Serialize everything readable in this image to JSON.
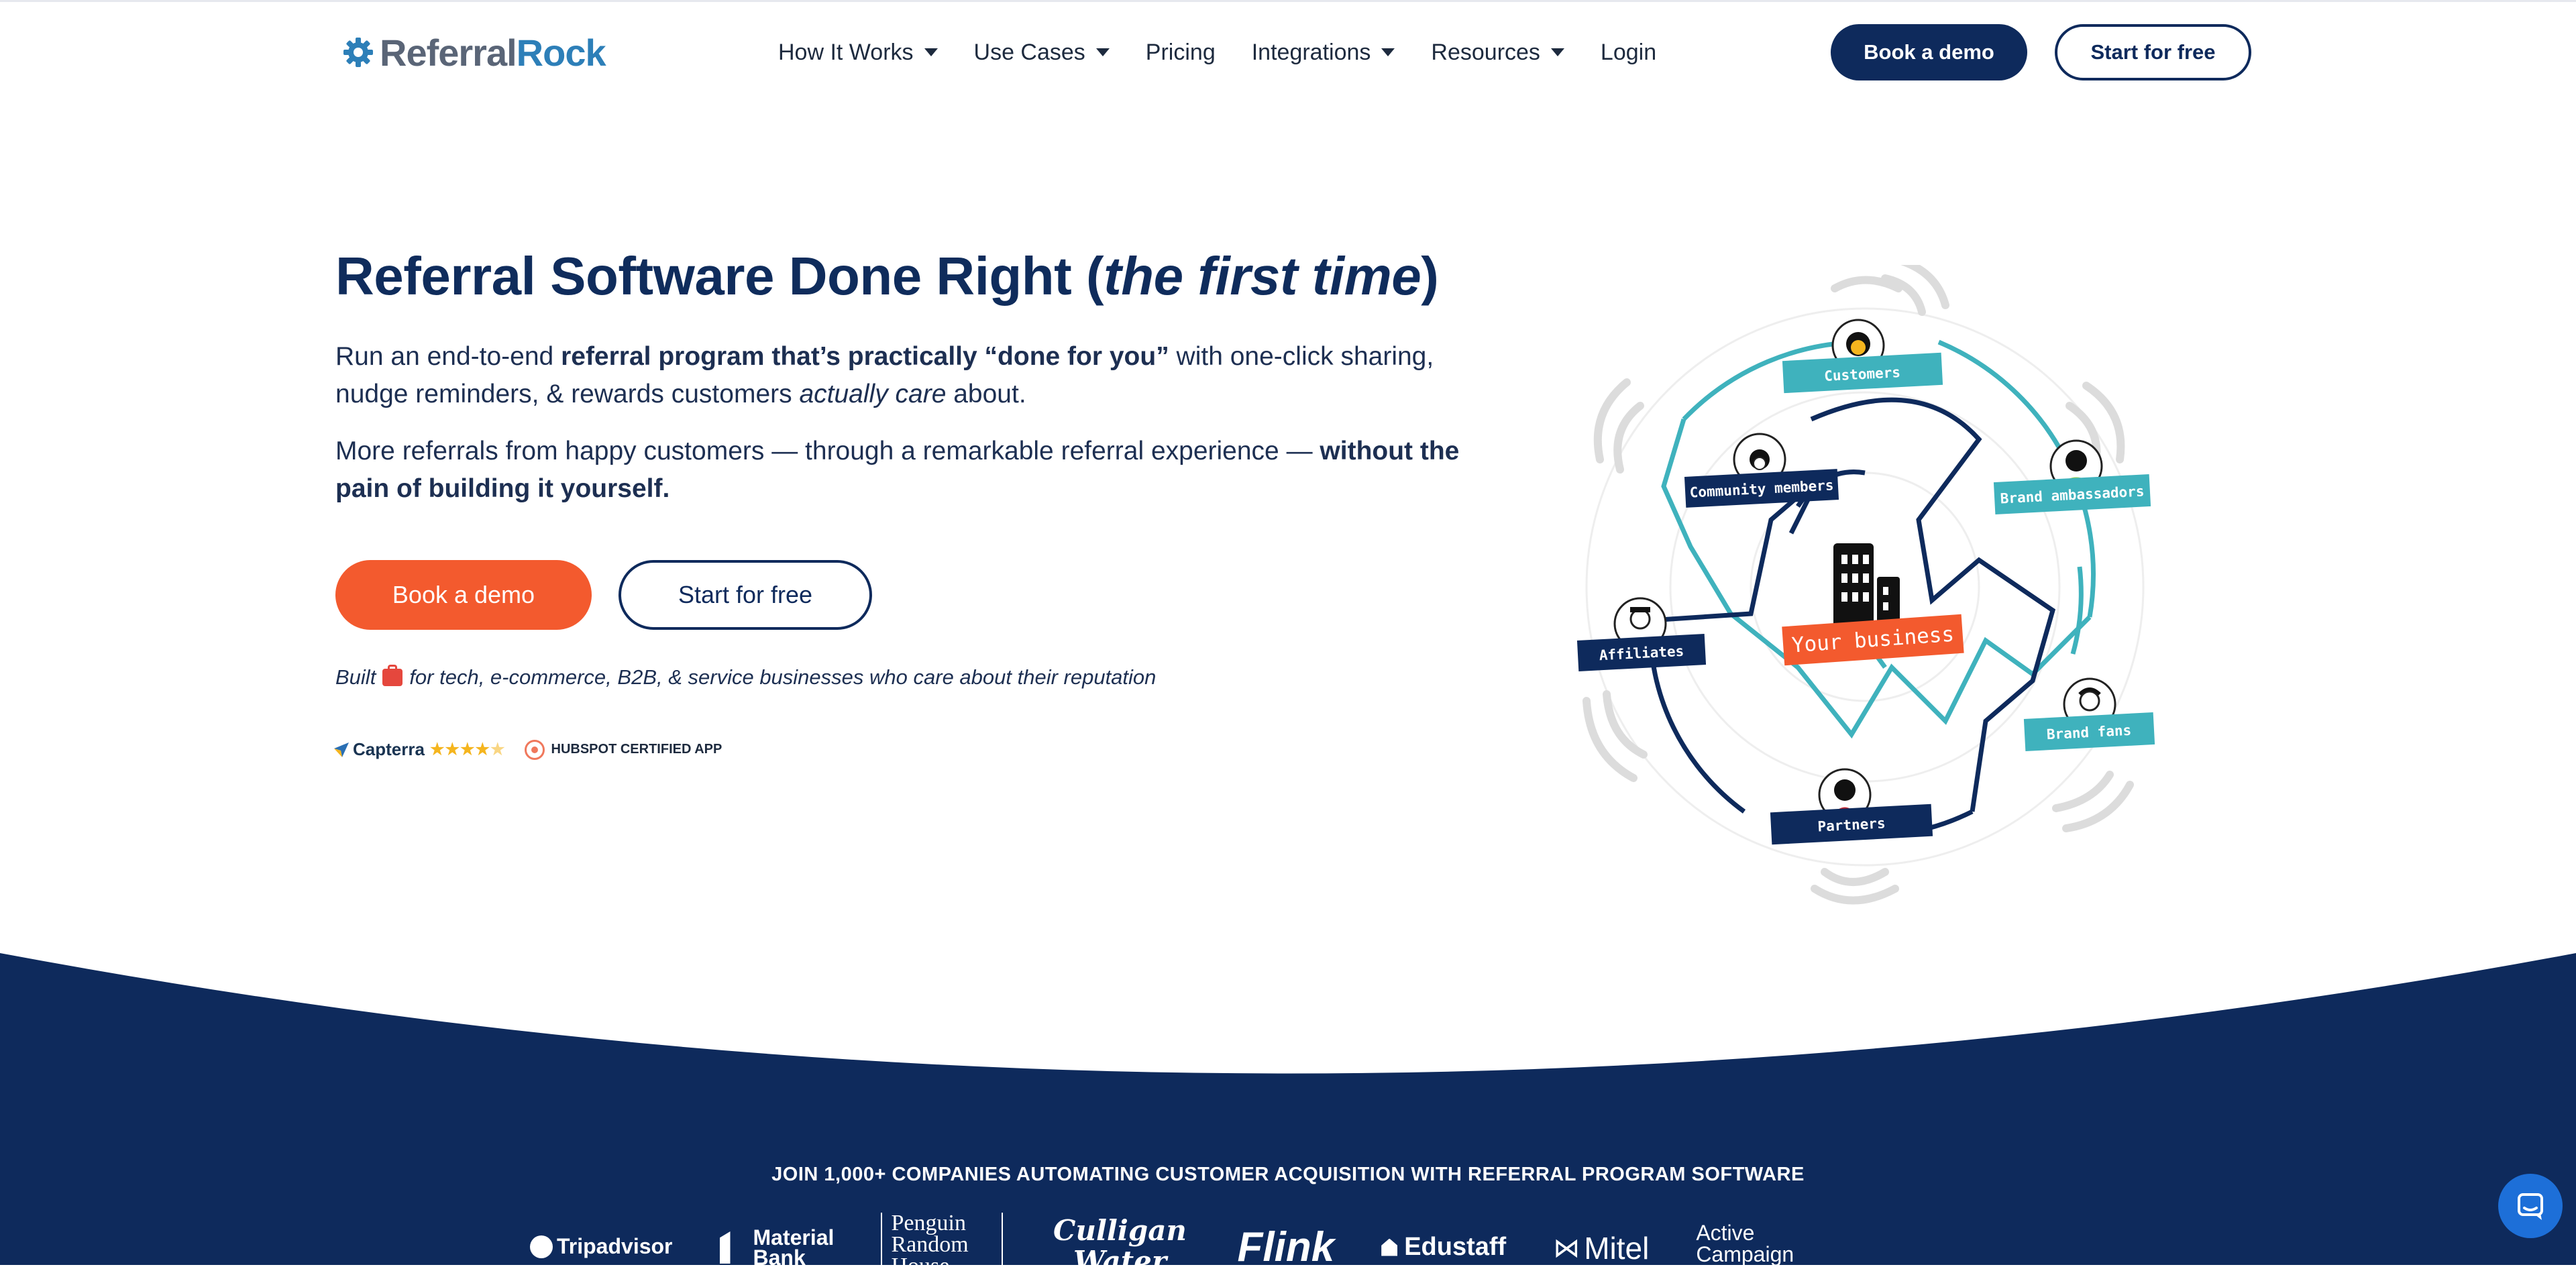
{
  "nav": {
    "logo_part1": "Referral",
    "logo_part2": "Rock",
    "items": [
      {
        "label": "How It Works",
        "dropdown": true
      },
      {
        "label": "Use Cases",
        "dropdown": true
      },
      {
        "label": "Pricing",
        "dropdown": false
      },
      {
        "label": "Integrations",
        "dropdown": true
      },
      {
        "label": "Resources",
        "dropdown": true
      },
      {
        "label": "Login",
        "dropdown": false
      }
    ],
    "book_demo": "Book a demo",
    "start_free": "Start for free"
  },
  "hero": {
    "title_start": "Referral Software Done Right (",
    "title_italic": "the first time",
    "title_end": ")",
    "p1_a": "Run an end-to-end ",
    "p1_bold": "referral program that’s practically “done for you”",
    "p1_b": " with one-click sharing, nudge reminders, & rewards customers ",
    "p1_italic": "actually care",
    "p1_c": " about.",
    "p2_a": "More referrals from happy customers — through a remarkable referral experience — ",
    "p2_bold": "without the pain of building it yourself.",
    "book_demo": "Book a demo",
    "start_free": "Start for free",
    "built_a": "Built",
    "built_b": "for tech, e-commerce, B2B, & service businesses who care about their reputation",
    "capterra": "Capterra",
    "capterra_rating": 4.5,
    "hubspot": "HUBSPOT CERTIFIED APP"
  },
  "illustration": {
    "center": "Your business",
    "tags": [
      "Customers",
      "Community members",
      "Brand ambassadors",
      "Affiliates",
      "Brand fans",
      "Partners"
    ]
  },
  "clients": {
    "heading": "JOIN 1,000+ COMPANIES AUTOMATING CUSTOMER ACQUISITION WITH REFERRAL PROGRAM SOFTWARE",
    "logos": [
      "Tripadvisor",
      "Material Bank",
      "Penguin Random House",
      "Culligan Water",
      "Flink",
      "Edustaff",
      "Mitel",
      "Active Campaign"
    ]
  },
  "colors": {
    "navy": "#0e2a5c",
    "orange": "#f35a2e",
    "teal": "#3fb2bd",
    "blue": "#2d7fb8"
  }
}
